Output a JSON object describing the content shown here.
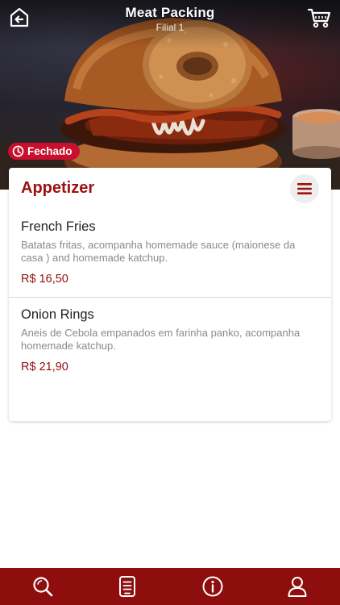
{
  "header": {
    "title": "Meat Packing",
    "subtitle": "Filial 1"
  },
  "hero": {
    "image": "burger-photo"
  },
  "status": {
    "label": "Fechado",
    "color": "#c8102e",
    "icon": "clock-icon"
  },
  "category": {
    "title": "Appetizer",
    "menu_icon": "hamburger-menu-icon"
  },
  "items": [
    {
      "name": "French Fries",
      "description": "Batatas fritas, acompanha homemade sauce (maionese da casa ) and homemade katchup.",
      "price": "R$ 16,50"
    },
    {
      "name": "Onion Rings",
      "description": "Aneis de Cebola empanados em farinha panko, acompanha homemade katchup.",
      "price": "R$ 21,90"
    }
  ],
  "nav": {
    "icons": [
      "search-icon",
      "menu-list-icon",
      "info-icon",
      "profile-icon"
    ],
    "background": "#8e0e0e"
  },
  "colors": {
    "accent": "#9b1010",
    "price": "#8f1111"
  }
}
